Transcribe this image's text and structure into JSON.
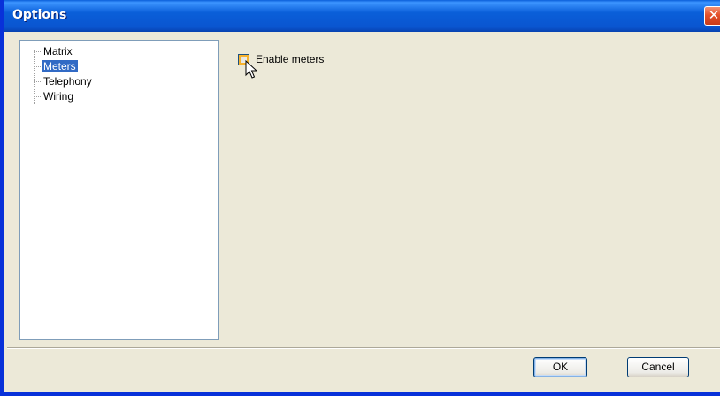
{
  "window": {
    "title": "Options",
    "close_glyph": "✕"
  },
  "tree": {
    "items": [
      {
        "label": "Matrix",
        "selected": false
      },
      {
        "label": "Meters",
        "selected": true
      },
      {
        "label": "Telephony",
        "selected": false
      },
      {
        "label": "Wiring",
        "selected": false
      }
    ]
  },
  "meters_page": {
    "enable_label": "Enable meters",
    "enable_checked": false
  },
  "buttons": {
    "ok_label": "OK",
    "cancel_label": "Cancel"
  },
  "colors": {
    "titlebar": "#0a5fd9",
    "selection": "#316ac5",
    "dialog_bg": "#ece9d8"
  },
  "icons": [
    "close-icon",
    "mouse-pointer-icon"
  ]
}
